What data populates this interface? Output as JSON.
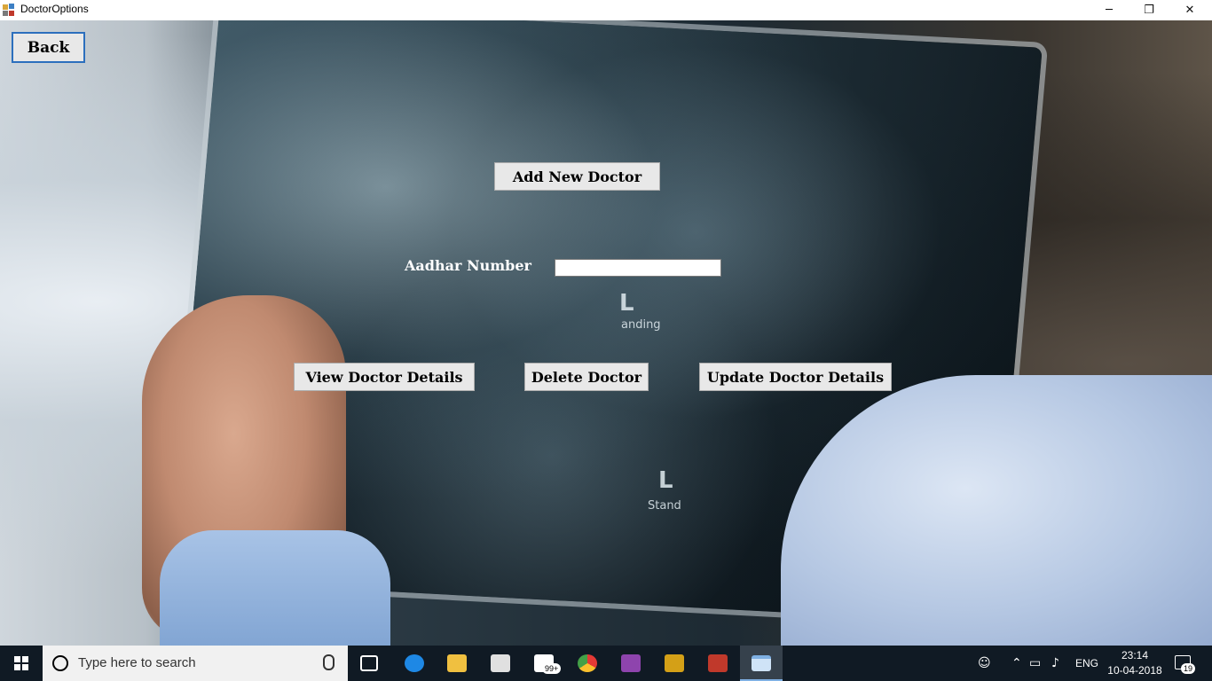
{
  "window": {
    "title": "DoctorOptions",
    "controls": {
      "minimize": "─",
      "maximize": "❐",
      "close": "✕"
    }
  },
  "form": {
    "back_label": "Back",
    "add_label": "Add New Doctor",
    "aadhar_label": "Aadhar Number",
    "aadhar_value": "",
    "view_label": "View Doctor Details",
    "delete_label": "Delete Doctor",
    "update_label": "Update Doctor Details",
    "background": {
      "markers": {
        "top_letter": "L",
        "top_text": "anding",
        "bottom_letter": "L",
        "bottom_text": "Stand"
      }
    }
  },
  "taskbar": {
    "search_placeholder": "Type here to search",
    "pinned": [
      {
        "name": "task-view",
        "icon": "task-view-icon"
      },
      {
        "name": "edge",
        "icon": "edge-icon",
        "color": "#1e88e5"
      },
      {
        "name": "file-explorer",
        "icon": "folder-icon",
        "color": "#f0c040"
      },
      {
        "name": "store",
        "icon": "store-icon",
        "color": "#e0e0e0"
      },
      {
        "name": "mail",
        "icon": "mail-icon",
        "color": "#ffffff"
      },
      {
        "name": "chrome",
        "icon": "chrome-icon",
        "color": "#e53935"
      },
      {
        "name": "visual-studio",
        "icon": "visual-studio-icon",
        "color": "#8e44ad"
      },
      {
        "name": "database-tool",
        "icon": "database-icon",
        "color": "#d4a017"
      },
      {
        "name": "app-tool",
        "icon": "toolbox-icon",
        "color": "#c0392b"
      },
      {
        "name": "doctor-options-window",
        "icon": "window-icon",
        "color": "#7fb0e3"
      }
    ],
    "mail_badge": "99+",
    "tray": {
      "language": "ENG",
      "time": "23:14",
      "date": "10-04-2018",
      "notification_count": "19"
    }
  }
}
